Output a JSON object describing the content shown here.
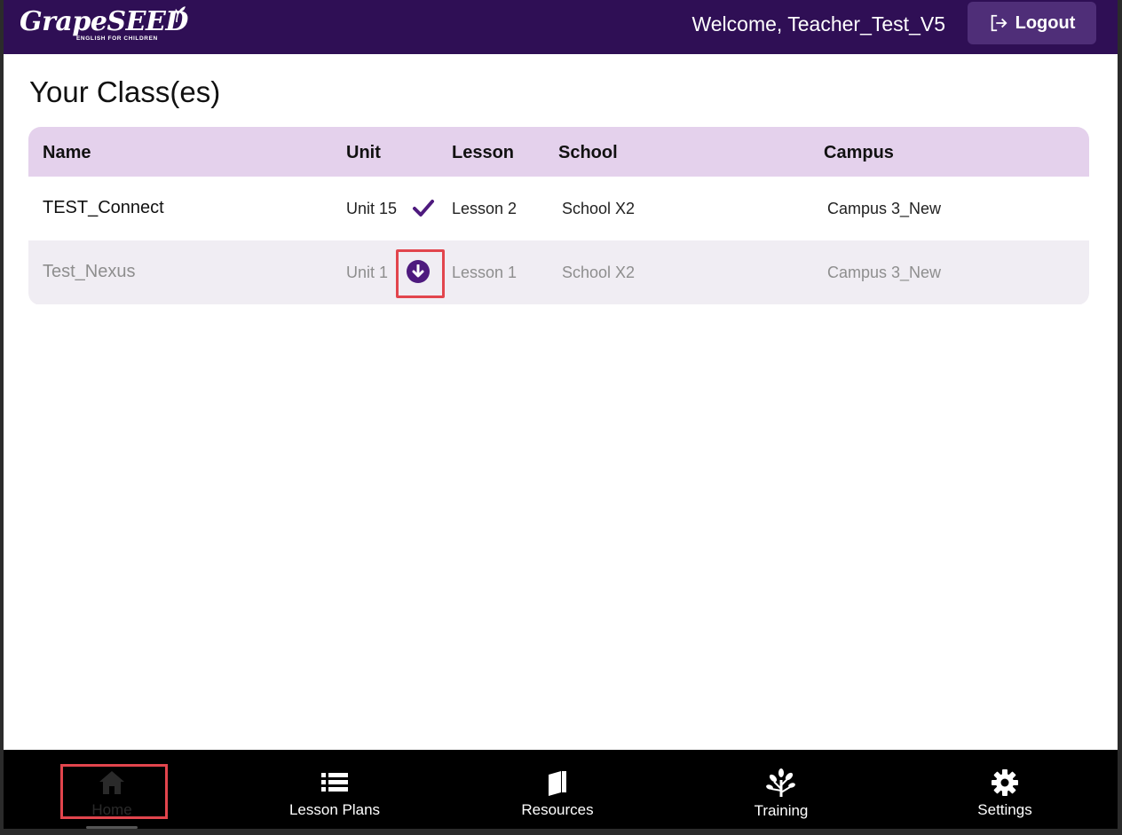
{
  "header": {
    "logo_text": "GrapeSEED",
    "logo_tagline": "ENGLISH FOR CHILDREN",
    "welcome": "Welcome, Teacher_Test_V5",
    "logout_label": "Logout"
  },
  "page": {
    "title": "Your Class(es)"
  },
  "table": {
    "columns": [
      "Name",
      "Unit",
      "Lesson",
      "School",
      "Campus"
    ],
    "rows": [
      {
        "name": "TEST_Connect",
        "unit": "Unit 15",
        "unit_status": "check-icon",
        "lesson": "Lesson 2",
        "school": "School X2",
        "campus": "Campus 3_New"
      },
      {
        "name": "Test_Nexus",
        "unit": "Unit 1",
        "unit_status": "download-icon",
        "lesson": "Lesson 1",
        "school": "School X2",
        "campus": "Campus 3_New"
      }
    ]
  },
  "nav": {
    "items": [
      {
        "label": "Home",
        "icon": "home-icon",
        "active": true
      },
      {
        "label": "Lesson Plans",
        "icon": "list-icon"
      },
      {
        "label": "Resources",
        "icon": "book-icon"
      },
      {
        "label": "Training",
        "icon": "tree-icon"
      },
      {
        "label": "Settings",
        "icon": "gear-icon"
      }
    ]
  },
  "colors": {
    "header_bg": "#2f0f55",
    "logout_bg": "#4f2e78",
    "table_header_bg": "#e4d1ec",
    "accent": "#4e1a7e",
    "highlight": "#e2454d"
  }
}
